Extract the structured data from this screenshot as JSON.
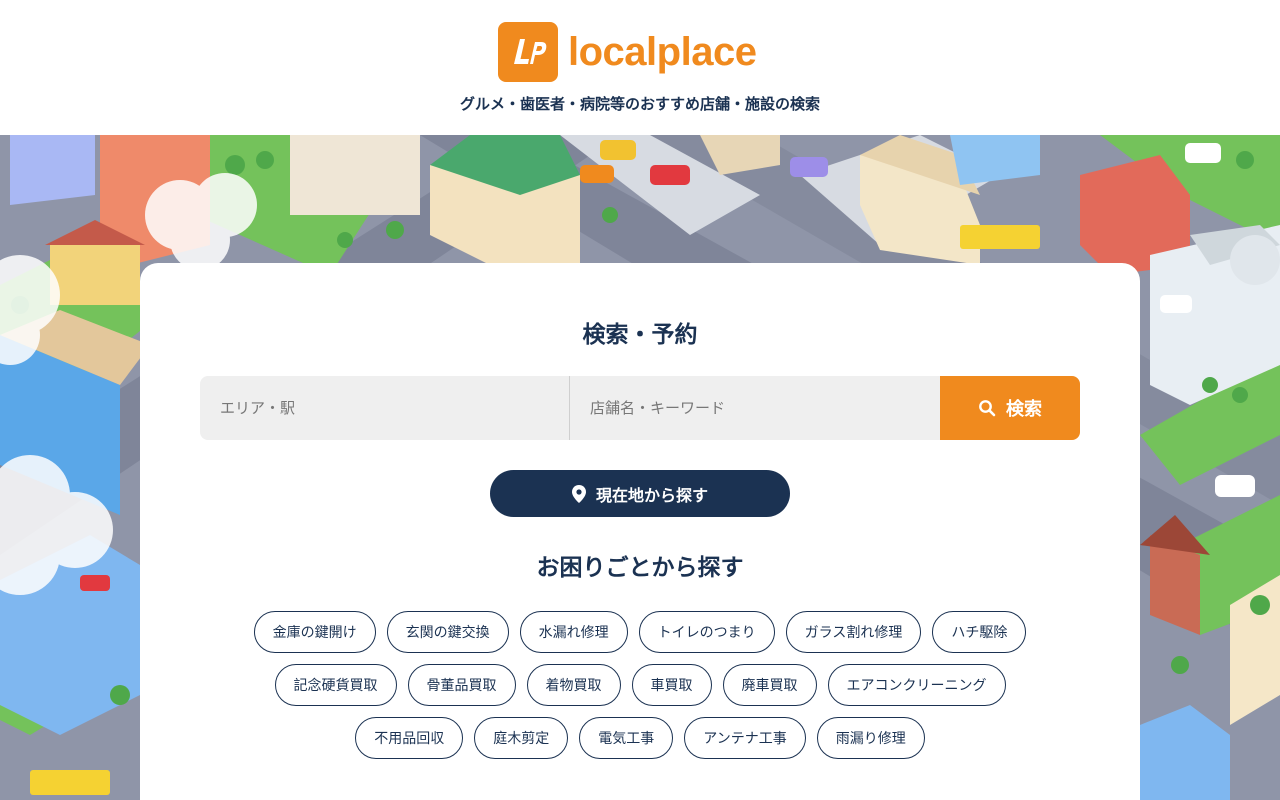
{
  "brand": {
    "name": "localplace",
    "mark": "Lp",
    "color": "#f08a1e",
    "navy": "#1b3252"
  },
  "header": {
    "tagline": "グルメ・歯医者・病院等のおすすめ店舗・施設の検索"
  },
  "search": {
    "title": "検索・予約",
    "area_placeholder": "エリア・駅",
    "keyword_placeholder": "店舗名・キーワード",
    "button_label": "検索",
    "button_icon": "search-icon",
    "location_label": "現在地から探す",
    "location_icon": "map-pin-icon"
  },
  "troubles": {
    "title": "お困りごとから探す",
    "rows": [
      [
        "金庫の鍵開け",
        "玄関の鍵交換",
        "水漏れ修理",
        "トイレのつまり",
        "ガラス割れ修理",
        "ハチ駆除"
      ],
      [
        "記念硬貨買取",
        "骨董品買取",
        "着物買取",
        "車買取",
        "廃車買取",
        "エアコンクリーニング"
      ],
      [
        "不用品回収",
        "庭木剪定",
        "電気工事",
        "アンテナ工事",
        "雨漏り修理"
      ]
    ]
  }
}
